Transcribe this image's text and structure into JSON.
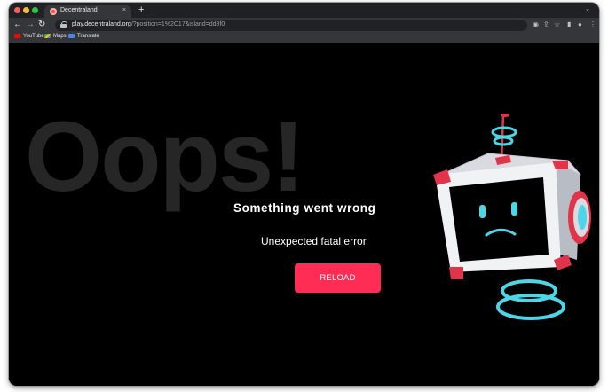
{
  "browser": {
    "tab_title": "Decentraland",
    "tab_close": "×",
    "new_tab": "+",
    "url_host": "play.decentraland.org",
    "url_path": "/?position=1%2C17&island=dd8f0",
    "bookmarks": [
      {
        "label": "YouTube",
        "icon": "youtube-icon"
      },
      {
        "label": "Maps",
        "icon": "maps-icon"
      },
      {
        "label": "Translate",
        "icon": "translate-icon"
      }
    ]
  },
  "page": {
    "background_text": "Oops!",
    "headline": "Something went wrong",
    "subline": "Unexpected fatal error",
    "reload_label": "RELOAD"
  },
  "colors": {
    "accent": "#ff2d55",
    "background": "#000000",
    "robot_cyan": "#4fd6e6",
    "robot_red": "#e0344a"
  }
}
